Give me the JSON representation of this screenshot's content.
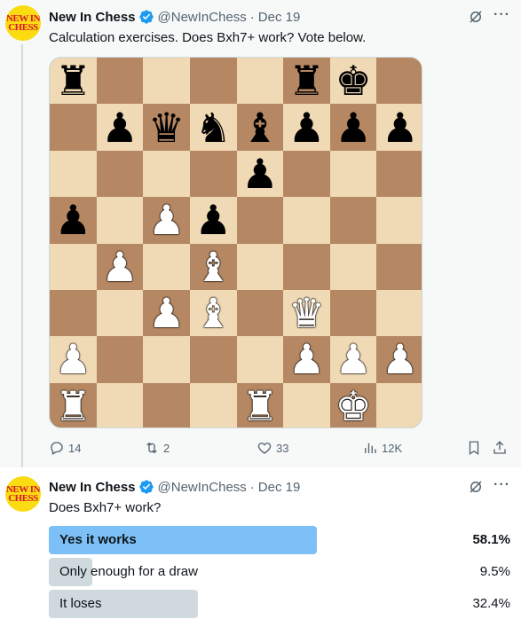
{
  "tweet1": {
    "avatar_lines": [
      "NEW IN",
      "CHESS"
    ],
    "name": "New In Chess",
    "handle": "@NewInChess",
    "separator": "·",
    "date": "Dec 19",
    "more": "···",
    "text": "Calculation exercises. Does Bxh7+ work? Vote below.",
    "board": [
      [
        "r",
        "",
        "",
        "",
        "",
        "r",
        "k",
        ""
      ],
      [
        "",
        "p",
        "q",
        "n",
        "b",
        "p",
        "p",
        "p"
      ],
      [
        "",
        "",
        "",
        "",
        "p",
        "",
        "",
        ""
      ],
      [
        "p",
        "",
        "P",
        "p",
        "",
        "",
        "",
        ""
      ],
      [
        "",
        "P",
        "",
        "B",
        "",
        "",
        "",
        ""
      ],
      [
        "",
        "",
        "P",
        "B",
        "",
        "Q",
        "",
        ""
      ],
      [
        "P",
        "",
        "",
        "",
        "",
        "P",
        "P",
        "P"
      ],
      [
        "R",
        "",
        "",
        "",
        "R",
        "",
        "K",
        ""
      ]
    ],
    "pieces": {
      "k": "♚",
      "q": "♛",
      "r": "♜",
      "b": "♝",
      "n": "♞",
      "p": "♟",
      "K": "♚",
      "Q": "♛",
      "R": "♜",
      "B": "♝",
      "N": "♞",
      "P": "♟"
    },
    "board_colors": {
      "light": "#f0d9b5",
      "dark": "#b58863"
    },
    "actions": {
      "reply_count": "14",
      "repost_count": "2",
      "like_count": "33",
      "view_count": "12K"
    }
  },
  "tweet2": {
    "avatar_lines": [
      "NEW IN",
      "CHESS"
    ],
    "name": "New In Chess",
    "handle": "@NewInChess",
    "separator": "·",
    "date": "Dec 19",
    "more": "···",
    "text": "Does Bxh7+ work?",
    "poll": [
      {
        "label": "Yes it works",
        "percent": "58.1%",
        "fraction": 0.581,
        "winner": true
      },
      {
        "label": "Only enough for a draw",
        "percent": "9.5%",
        "fraction": 0.095,
        "winner": false
      },
      {
        "label": "It loses",
        "percent": "32.4%",
        "fraction": 0.324,
        "winner": false
      }
    ]
  },
  "colors": {
    "verified": "#1d9bf0",
    "poll_winner": "#7cc0f7",
    "poll_other": "#cfd9de",
    "secondary_text": "#536471"
  }
}
